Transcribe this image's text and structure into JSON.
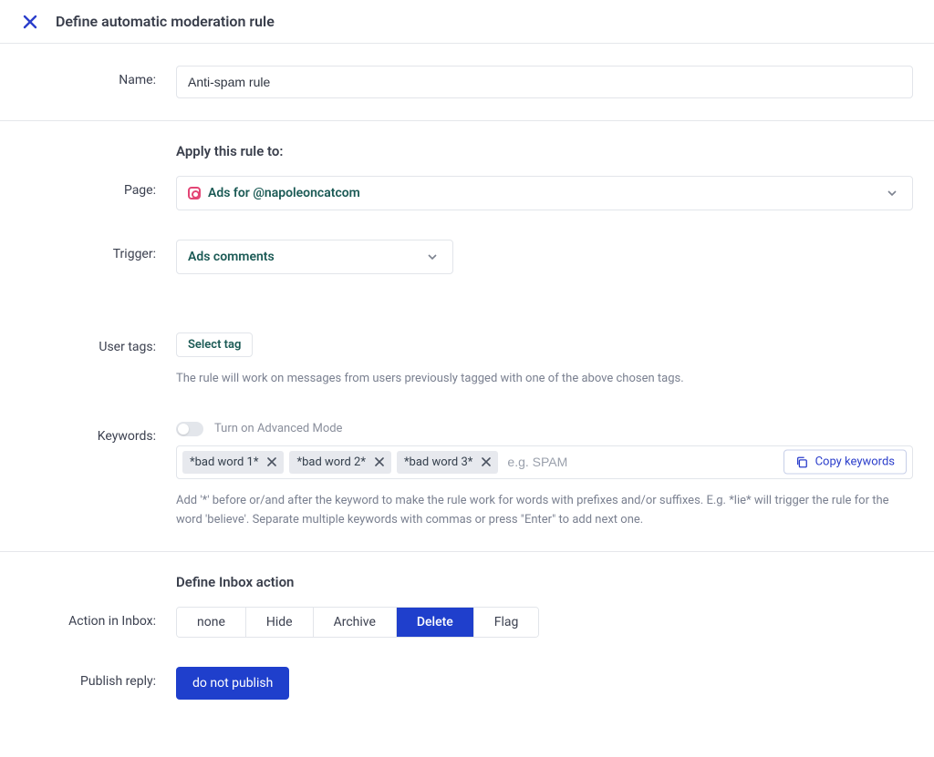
{
  "header": {
    "title": "Define automatic moderation rule"
  },
  "name": {
    "label": "Name:",
    "value": "Anti-spam rule"
  },
  "apply": {
    "heading": "Apply this rule to:",
    "page_label": "Page:",
    "page_value": "Ads for @napoleoncatcom",
    "trigger_label": "Trigger:",
    "trigger_value": "Ads comments"
  },
  "user_tags": {
    "label": "User tags:",
    "button": "Select tag",
    "help": "The rule will work on messages from users previously tagged with one of the above chosen tags."
  },
  "keywords": {
    "label": "Keywords:",
    "advanced_toggle": "Turn on Advanced Mode",
    "chips": [
      "*bad word 1*",
      "*bad word 2*",
      "*bad word 3*"
    ],
    "placeholder": "e.g. SPAM",
    "copy_button": "Copy keywords",
    "help": "Add '*' before or/and after the keyword to make the rule work for words with prefixes and/or suffixes. E.g. *lie* will trigger the rule for the word 'believe'. Separate multiple keywords with commas or press \"Enter\" to add next one."
  },
  "inbox_action": {
    "heading": "Define Inbox action",
    "action_label": "Action in Inbox:",
    "options": [
      "none",
      "Hide",
      "Archive",
      "Delete",
      "Flag"
    ],
    "active": "Delete",
    "reply_label": "Publish reply:",
    "reply_button": "do not publish"
  }
}
